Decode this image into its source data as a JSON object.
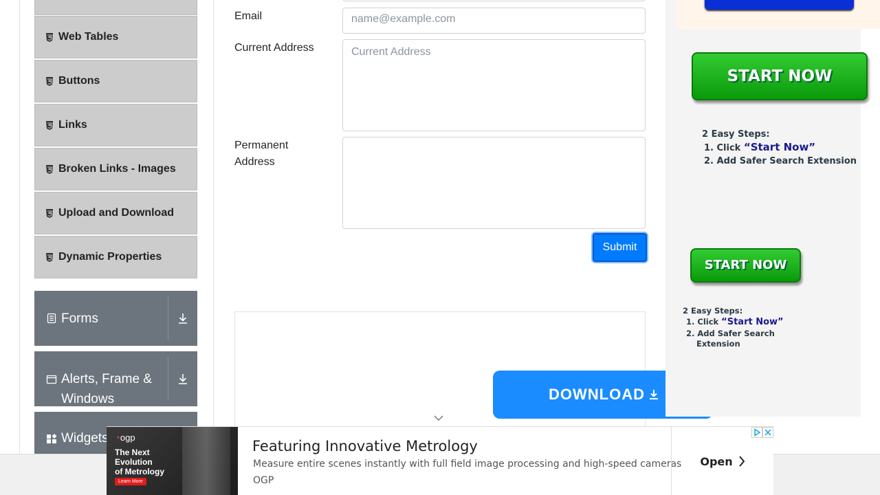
{
  "sidebar": {
    "items": [
      {
        "label": "Web Tables"
      },
      {
        "label": "Buttons"
      },
      {
        "label": "Links"
      },
      {
        "label": "Broken Links - Images"
      },
      {
        "label": "Upload and Download"
      },
      {
        "label": "Dynamic Properties"
      }
    ],
    "groups": [
      {
        "label": "Forms",
        "icon": "document-icon"
      },
      {
        "label": "Alerts, Frame &",
        "label2": "Windows",
        "icon": "window-icon"
      },
      {
        "label": "Widgets",
        "icon": "widgets-icon"
      }
    ]
  },
  "form": {
    "email_label": "Email",
    "email_placeholder": "name@example.com",
    "current_address_label": "Current Address",
    "current_address_placeholder": "Current Address",
    "permanent_address_label1": "Permanent",
    "permanent_address_label2": "Address",
    "submit_label": "Submit"
  },
  "ad_center": {
    "download_label": "DOWNLOAD"
  },
  "ad_right": {
    "start_label": "START NOW",
    "steps_title": "2 Easy Steps:",
    "step1_prefix": "1. Click ",
    "step1_quote": "“Start Now”",
    "step2": "2. Add Safer Search Extension",
    "step2a": "2. Add Safer Search",
    "step2b": "Extension"
  },
  "ad_bottom": {
    "brand": "ogp",
    "tagline": [
      "The Next",
      "Evolution",
      "of Metrology"
    ],
    "learn_more": "Learn More",
    "title": "Featuring Innovative Metrology",
    "description": "Measure entire scenes instantly with full field image processing and high-speed cameras",
    "advertiser": "OGP",
    "open_label": "Open"
  },
  "colors": {
    "menu_bg": "#cccccc",
    "group_bg": "#6c757d",
    "submit_bg": "#007bff",
    "download_bg": "#1a8cff",
    "start_green": "#22b322"
  }
}
